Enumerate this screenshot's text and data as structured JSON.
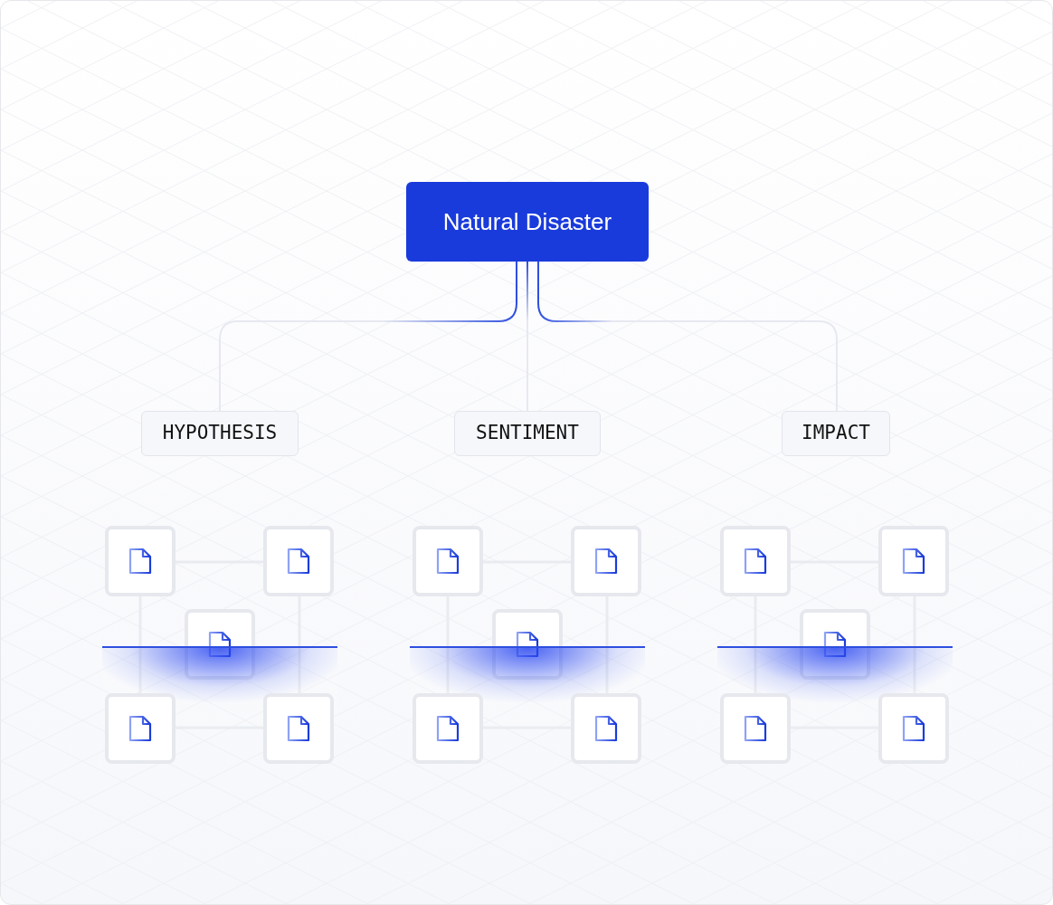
{
  "root": {
    "label": "Natural Disaster"
  },
  "categories": [
    {
      "label": "HYPOTHESIS"
    },
    {
      "label": "SENTIMENT"
    },
    {
      "label": "IMPACT"
    }
  ]
}
